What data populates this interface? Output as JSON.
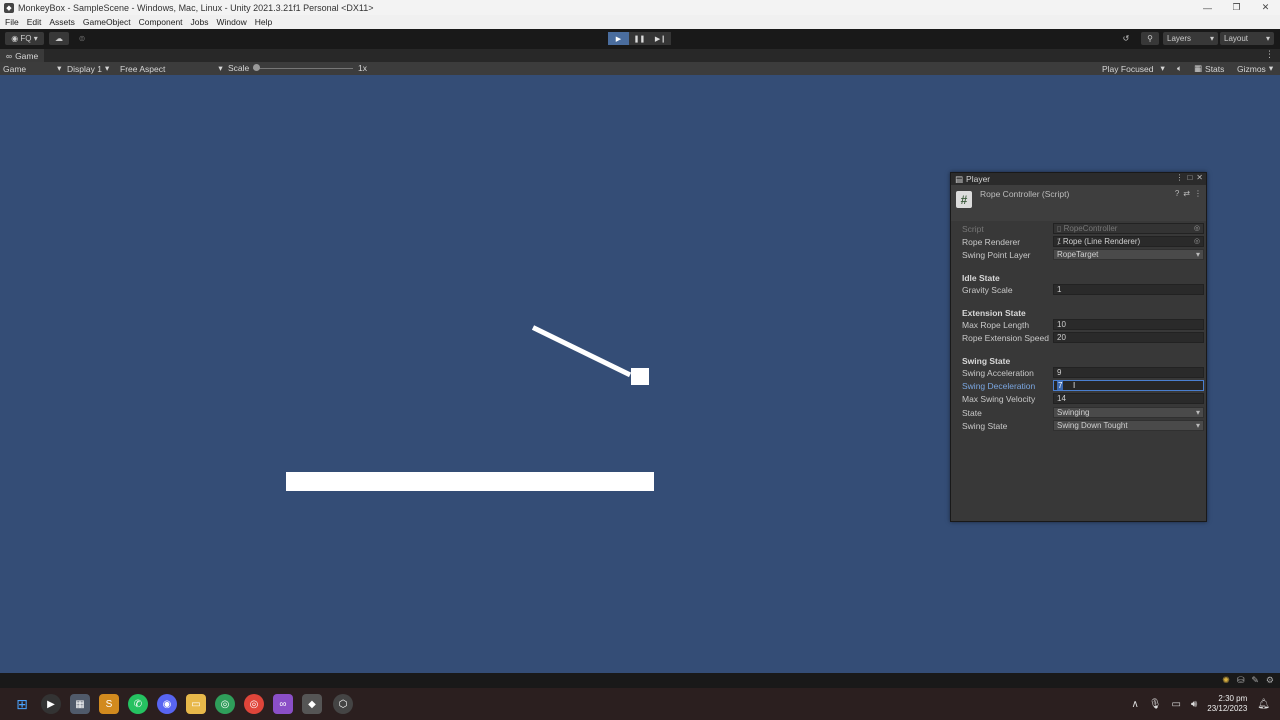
{
  "window": {
    "title": "MonkeyBox - SampleScene - Windows, Mac, Linux - Unity 2021.3.21f1 Personal <DX11>",
    "controls": {
      "minimize": "—",
      "maximize": "❐",
      "close": "✕"
    }
  },
  "menu": [
    "File",
    "Edit",
    "Assets",
    "GameObject",
    "Component",
    "Jobs",
    "Window",
    "Help"
  ],
  "toolbar": {
    "account_label": "FQ",
    "play_icon": "▶",
    "pause_icon": "❚❚",
    "step_icon": "▶❙",
    "layers_label": "Layers",
    "layout_label": "Layout"
  },
  "game_tab": {
    "label": "Game"
  },
  "game_bar": {
    "mode": "Game",
    "display": "Display 1",
    "aspect": "Free Aspect",
    "scale_label": "Scale",
    "scale_value": "1x",
    "scale_level": 0,
    "play_focused": "Play Focused",
    "stats": "Stats",
    "gizmos": "Gizmos"
  },
  "inspector": {
    "tab_label": "Player",
    "component_title": "Rope Controller (Script)",
    "fields": {
      "script": {
        "label": "Script",
        "value": "RopeController"
      },
      "rope_renderer": {
        "label": "Rope Renderer",
        "value": "Rope (Line Renderer)"
      },
      "swing_point_layer": {
        "label": "Swing Point Layer",
        "value": "RopeTarget"
      },
      "idle_header": "Idle State",
      "gravity_scale": {
        "label": "Gravity Scale",
        "value": "1"
      },
      "extension_header": "Extension State",
      "max_rope_length": {
        "label": "Max Rope Length",
        "value": "10"
      },
      "rope_extension_speed": {
        "label": "Rope Extension Speed",
        "value": "20"
      },
      "swing_header": "Swing State",
      "swing_acceleration": {
        "label": "Swing Acceleration",
        "value": "9"
      },
      "swing_deceleration": {
        "label": "Swing Deceleration",
        "value": "7"
      },
      "max_swing_velocity": {
        "label": "Max Swing Velocity",
        "value": "14"
      },
      "state": {
        "label": "State",
        "value": "Swinging"
      },
      "swing_state": {
        "label": "Swing State",
        "value": "Swing Down Tought"
      }
    }
  },
  "taskbar": {
    "time": "2:30 pm",
    "date": "23/12/2023"
  }
}
